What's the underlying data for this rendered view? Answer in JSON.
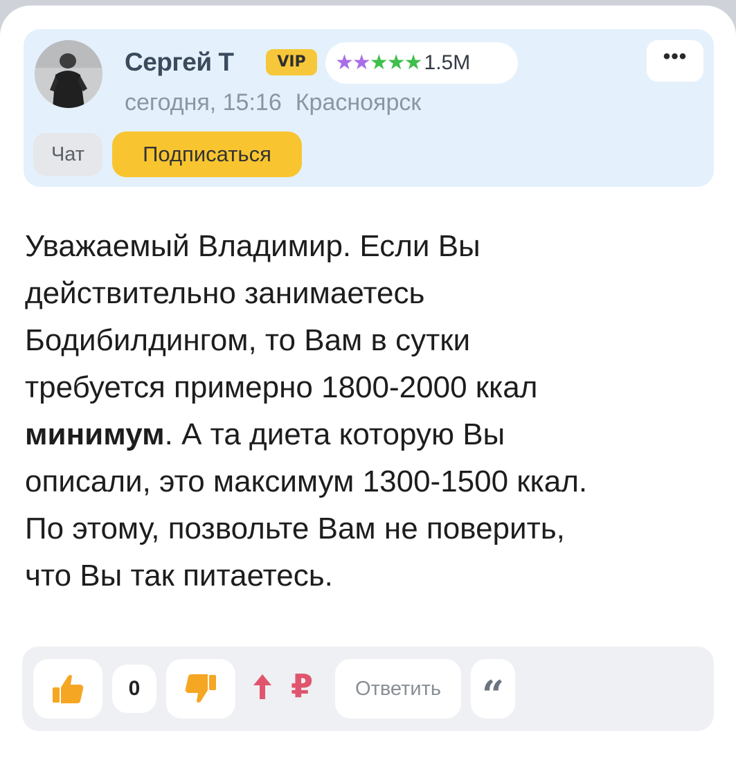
{
  "comment": {
    "author": {
      "name": "Сергей Т",
      "badge": "VIP",
      "stars": [
        "#a86ee8",
        "#a86ee8",
        "#3fbf4c",
        "#3fbf4c",
        "#3fbf4c"
      ],
      "rating": "1.5M",
      "avatar_icon": "user-avatar-photo"
    },
    "date": "сегодня, 15:16",
    "city": "Красноярск",
    "more_label": "•••",
    "chat_label": "Чат",
    "subscribe_label": "Подписаться",
    "text": {
      "line1": "Уважаемый Владимир. Если Вы",
      "line2": "действительно занимаетесь",
      "line3": "Бодибилдингом, то Вам в сутки",
      "line4": "требуется примерно 1800-2000 ккал",
      "bold_word": "минимум",
      "line5_rest": ". А та диета которую Вы",
      "line6": "описали, это максимум 1300-1500 ккал.",
      "line7": "По этому, позвольте Вам не поверить,",
      "line8": "что Вы так питаетесь."
    },
    "actions": {
      "like_icon": "thumbs-up-icon",
      "like_count": "0",
      "dislike_icon": "thumbs-down-icon",
      "boost_icon": "arrow-up-icon",
      "ruble_symbol": "₽",
      "reply_label": "Ответить",
      "quote_glyph": "“"
    }
  },
  "colors": {
    "header_bg": "#e4f1fc",
    "vip": "#f6c73a",
    "subscribe": "#f8c530",
    "like": "#f5a623",
    "accent_red": "#e0556d"
  }
}
